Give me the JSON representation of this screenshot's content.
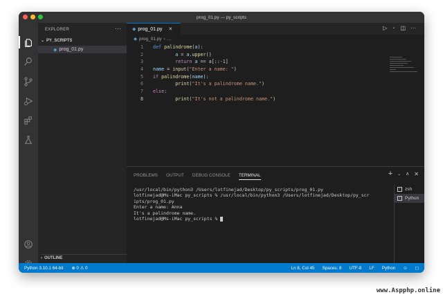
{
  "window": {
    "title": "prog_01.py — py_scripts"
  },
  "activity_bar": {
    "icons": [
      "files-icon",
      "search-icon",
      "source-control-icon",
      "run-debug-icon",
      "extensions-icon",
      "testing-icon",
      "account-icon",
      "settings-gear-icon"
    ],
    "settings_badge": "1"
  },
  "sidebar": {
    "title": "EXPLORER",
    "more": "···",
    "folder": "PY_SCRIPTS",
    "files": [
      {
        "name": "prog_01.py"
      }
    ],
    "outline": "OUTLINE"
  },
  "editor": {
    "tab_label": "prog_01.py",
    "tab_close": "✕",
    "breadcrumb_file": "prog_01.py",
    "breadcrumb_more": "...",
    "lines": [
      {
        "num": "1",
        "code": "def palindrome(a):"
      },
      {
        "num": "2",
        "code": "        a = a.upper()"
      },
      {
        "num": "3",
        "code": "        return a == a[::-1]"
      },
      {
        "num": "4",
        "code": "name = input(\"Enter a name: \")"
      },
      {
        "num": "5",
        "code": "if palindrome(name):"
      },
      {
        "num": "6",
        "code": "        print(\"It's a palindrome name.\")"
      },
      {
        "num": "7",
        "code": "else:"
      },
      {
        "num": "8",
        "code": "        print(\"It's not a palindrome name.\")"
      }
    ]
  },
  "panel": {
    "tabs": [
      "PROBLEMS",
      "OUTPUT",
      "DEBUG CONSOLE",
      "TERMINAL"
    ],
    "active_tab": "TERMINAL",
    "terminal_lines": [
      "/usr/local/bin/python3 /Users/lotfinejad/Desktop/py_scripts/prog_01.py",
      "lotfinejad@Ms-iMac py_scripts % /usr/local/bin/python3 /Users/lotfinejad/Desktop/py_scr",
      "ipts/prog_01.py",
      "Enter a name: Anna",
      "It's a palindrome name.",
      "lotfinejad@Ms-iMac py_scripts % "
    ],
    "terminals": [
      {
        "name": "zsh"
      },
      {
        "name": "Python"
      }
    ]
  },
  "statusbar": {
    "interpreter": "Python 3.10.1 64-bit",
    "problems": "⊗ 0 ⚠ 0",
    "position": "Ln 8, Col 45",
    "spaces": "Spaces: 8",
    "encoding": "UTF-8",
    "eol": "LF",
    "language": "Python"
  },
  "watermark": "www.Aspphp.online",
  "colors": {
    "accent": "#007acc",
    "keyword": "#569cd6",
    "string": "#ce9178"
  }
}
